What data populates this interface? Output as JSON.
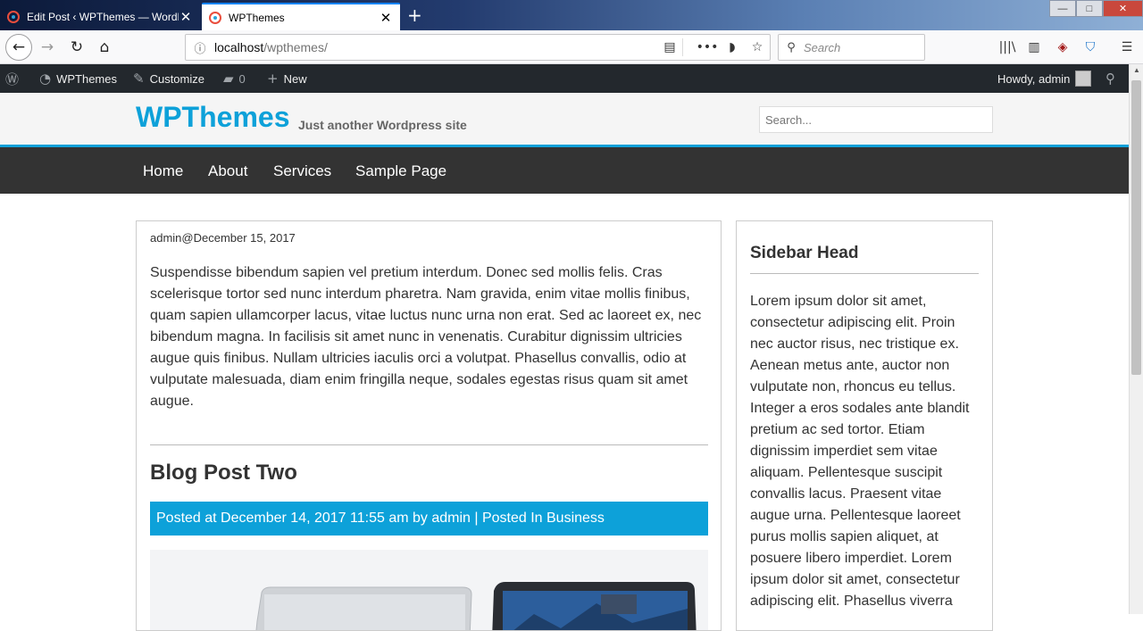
{
  "browser": {
    "tabs": [
      {
        "title": "Edit Post ‹ WPThemes — WordPress",
        "active": false
      },
      {
        "title": "WPThemes",
        "active": true
      }
    ],
    "url_host": "localhost",
    "url_path": "/wpthemes/",
    "search_placeholder": "Search",
    "icons": {
      "back": "←",
      "forward": "→",
      "reload": "↻",
      "home": "⌂",
      "info": "ⓘ",
      "reader": "▤",
      "more": "•••",
      "pocket": "◗",
      "star": "☆",
      "library": "|||\\",
      "sidebar": "▥",
      "ublock": "◈",
      "shield": "⛉",
      "menu": "☰",
      "search": "⚲",
      "close": "✕",
      "newtab": "+",
      "minimize": "—",
      "maximize": "□",
      "winclose": "✕"
    }
  },
  "adminbar": {
    "site_name": "WPThemes",
    "customize": "Customize",
    "comments_count": "0",
    "new_label": "New",
    "howdy": "Howdy, admin",
    "icons": {
      "wp": "Ⓦ",
      "dashboard": "◔",
      "brush": "✎",
      "comment": "▰",
      "plus": "+",
      "search": "⚲"
    }
  },
  "site": {
    "title": "WPThemes",
    "tagline": "Just another Wordpress site",
    "search_placeholder": "Search...",
    "nav": [
      "Home",
      "About",
      "Services",
      "Sample Page"
    ]
  },
  "post1": {
    "meta": "admin@December 15, 2017",
    "body": "Suspendisse bibendum sapien vel pretium interdum. Donec sed mollis felis. Cras scelerisque tortor sed nunc interdum pharetra. Nam gravida, enim vitae mollis finibus, quam sapien ullamcorper lacus, vitae luctus nunc urna non erat. Sed ac laoreet ex, nec bibendum magna. In facilisis sit amet nunc in venenatis. Curabitur dignissim ultricies augue quis finibus. Nullam ultricies iaculis orci a volutpat. Phasellus convallis, odio at vulputate malesuada, diam enim fringilla neque, sodales egestas risus quam sit amet augue."
  },
  "post2": {
    "title": "Blog Post Two",
    "meta": "Posted at December 14, 2017 11:55 am by admin | Posted In Business"
  },
  "sidebar": {
    "heading": "Sidebar Head",
    "text": "Lorem ipsum dolor sit amet, consectetur adipiscing elit. Proin nec auctor risus, nec tristique ex. Aenean metus ante, auctor non vulputate non, rhoncus eu tellus. Integer a eros sodales ante blandit pretium ac sed tortor. Etiam dignissim imperdiet sem vitae aliquam. Pellentesque suscipit convallis lacus. Praesent vitae augue urna. Pellentesque laoreet purus mollis sapien aliquet, at posuere libero imperdiet. Lorem ipsum dolor sit amet, consectetur adipiscing elit. Phasellus viverra"
  },
  "colors": {
    "accent": "#0da1d9",
    "nav_bg": "#333333",
    "adminbar_bg": "#23282d"
  }
}
